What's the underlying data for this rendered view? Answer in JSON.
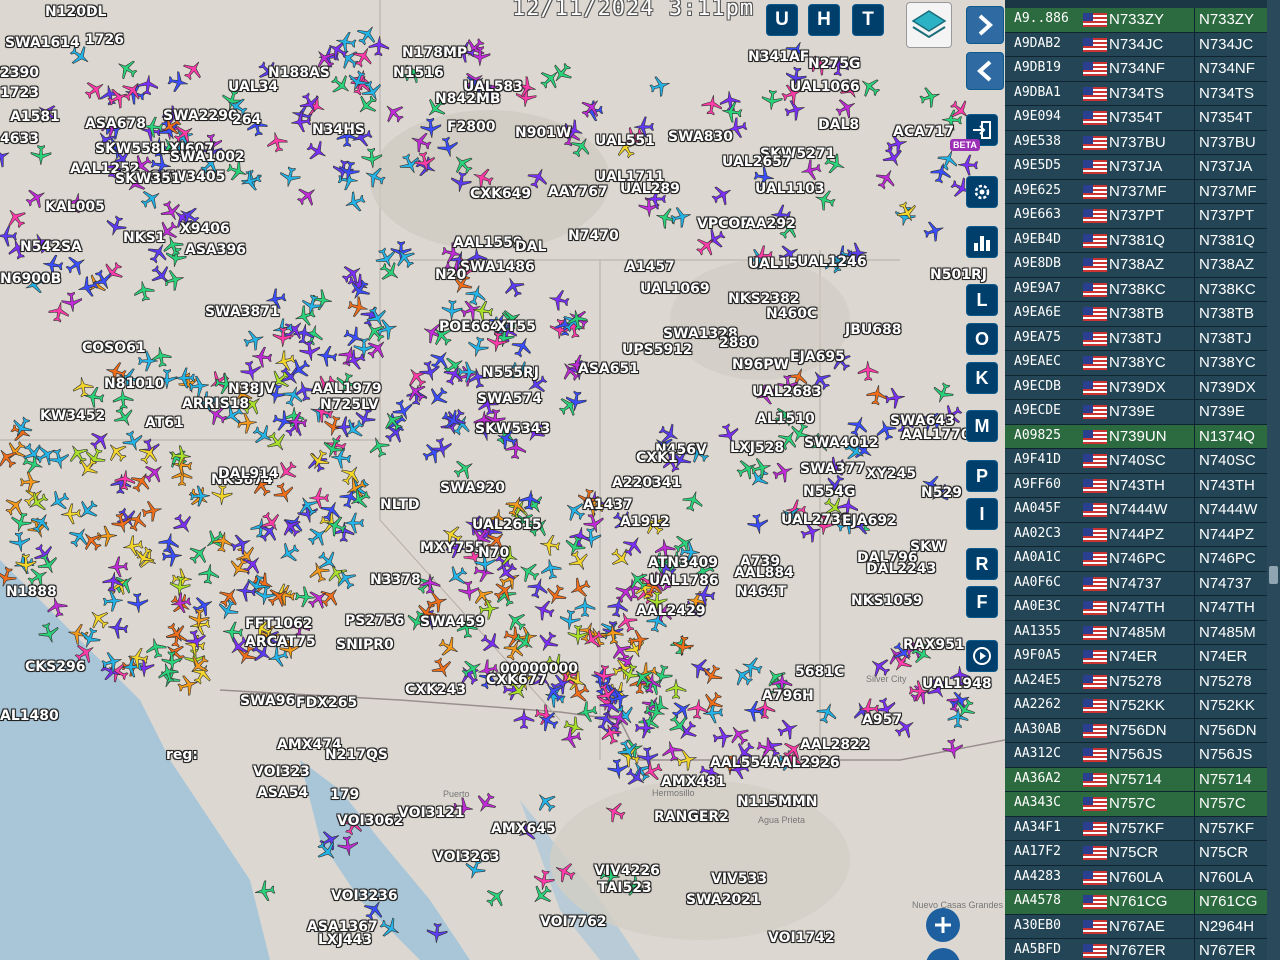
{
  "timestamp": "12/11/2024  3:11pm",
  "top_buttons": [
    "U",
    "H",
    "T"
  ],
  "side_buttons": [
    "L",
    "O",
    "K",
    "M",
    "P",
    "I",
    "R",
    "F"
  ],
  "beta_badge": "BETA",
  "icons": {
    "layers": "layers-icon",
    "next": "chevron-right-icon",
    "back": "chevron-left-icon",
    "login": "login-icon",
    "settings": "gear-icon",
    "stats": "bar-chart-icon",
    "replay": "replay-icon",
    "zoom_in": "plus-icon",
    "panel_toggle": "expand-collapse-icon"
  },
  "colors": {
    "panel_bg": "#1b3645",
    "row_bg": "#234556",
    "row_highlight": "#2c6a3f",
    "button_bg": "#003f6b"
  },
  "map_labels": [
    {
      "t": "N120DL"
    },
    {
      "t": "SWA1614"
    },
    {
      "t": "1726"
    },
    {
      "t": "2390"
    },
    {
      "t": "1723"
    },
    {
      "t": "A1581"
    },
    {
      "t": "ASA678"
    },
    {
      "t": "4633"
    },
    {
      "t": "SKW558"
    },
    {
      "t": "LXJ607"
    },
    {
      "t": "SWA1002"
    },
    {
      "t": "AAL1252"
    },
    {
      "t": "SKW3405"
    },
    {
      "t": "KAL005"
    },
    {
      "t": "SKW351"
    },
    {
      "t": "N542SA"
    },
    {
      "t": "NKS1"
    },
    {
      "t": "X9406"
    },
    {
      "t": "ASA396"
    },
    {
      "t": "N6900B"
    },
    {
      "t": "N178MP"
    },
    {
      "t": "N188AS"
    },
    {
      "t": "N1516"
    },
    {
      "t": "UAL34"
    },
    {
      "t": "SWA2290"
    },
    {
      "t": "264"
    },
    {
      "t": "N34HS"
    },
    {
      "t": "N842MB"
    },
    {
      "t": "UAL583"
    },
    {
      "t": "F2800"
    },
    {
      "t": "N901W"
    },
    {
      "t": "UAL551"
    },
    {
      "t": "SWA830"
    },
    {
      "t": "UAL1711"
    },
    {
      "t": "UAL289"
    },
    {
      "t": "AAY767"
    },
    {
      "t": "CXK649"
    },
    {
      "t": "UAL1103"
    },
    {
      "t": "N341AF"
    },
    {
      "t": "N275G"
    },
    {
      "t": "UAL1066"
    },
    {
      "t": "DAL8"
    },
    {
      "t": "ACA717"
    },
    {
      "t": "SKW5271"
    },
    {
      "t": "UAL2657"
    },
    {
      "t": "AAL1559"
    },
    {
      "t": "DAL"
    },
    {
      "t": "N7470"
    },
    {
      "t": "VPCOP"
    },
    {
      "t": "AA292"
    },
    {
      "t": "UAL15"
    },
    {
      "t": "UAL1246"
    },
    {
      "t": "N501RJ"
    },
    {
      "t": "SWA1486"
    },
    {
      "t": "UAL1069"
    },
    {
      "t": "N20"
    },
    {
      "t": "A1457"
    },
    {
      "t": "NKS2382"
    },
    {
      "t": "N460C"
    },
    {
      "t": "JBU688"
    },
    {
      "t": "SWA3871"
    },
    {
      "t": "POE664"
    },
    {
      "t": "XT55"
    },
    {
      "t": "SWA1328"
    },
    {
      "t": "UPS5912"
    },
    {
      "t": "2880"
    },
    {
      "t": "N96PW"
    },
    {
      "t": "EJA695"
    },
    {
      "t": "AAL1979"
    },
    {
      "t": "N725LV"
    },
    {
      "t": "N555RJ"
    },
    {
      "t": "ASA651"
    },
    {
      "t": "UAL2683"
    },
    {
      "t": "COSO61"
    },
    {
      "t": "N81010"
    },
    {
      "t": "ARRIS18"
    },
    {
      "t": "N38JV"
    },
    {
      "t": "KW3452"
    },
    {
      "t": "AT61"
    },
    {
      "t": "SWA574"
    },
    {
      "t": "SKW5343"
    },
    {
      "t": "AL1510"
    },
    {
      "t": "SWA4012"
    },
    {
      "t": "SWA643"
    },
    {
      "t": "AAL1770"
    },
    {
      "t": "N456V"
    },
    {
      "t": "CXK1"
    },
    {
      "t": "LXJ528"
    },
    {
      "t": "NKS874"
    },
    {
      "t": "DAL914"
    },
    {
      "t": "SWA920"
    },
    {
      "t": "A220341"
    },
    {
      "t": "SWA377"
    },
    {
      "t": "XY245"
    },
    {
      "t": "N554G"
    },
    {
      "t": "N529"
    },
    {
      "t": "NLTD"
    },
    {
      "t": "A1437"
    },
    {
      "t": "UAL2615"
    },
    {
      "t": "A1912"
    },
    {
      "t": "UAL2739"
    },
    {
      "t": "EJA692"
    },
    {
      "t": "MXY755"
    },
    {
      "t": "N70"
    },
    {
      "t": "SKW"
    },
    {
      "t": "N3378"
    },
    {
      "t": "ATN3409"
    },
    {
      "t": "A739"
    },
    {
      "t": "AAL884"
    },
    {
      "t": "DAL796"
    },
    {
      "t": "DAL2243"
    },
    {
      "t": "UAL1786"
    },
    {
      "t": "N464T"
    },
    {
      "t": "NKS1059"
    },
    {
      "t": "FFT1062"
    },
    {
      "t": "ARCAT75"
    },
    {
      "t": "SNIPR0"
    },
    {
      "t": "SWA459"
    },
    {
      "t": "PS2756"
    },
    {
      "t": "AAL2429"
    },
    {
      "t": "RAX951"
    },
    {
      "t": "UAL1948"
    },
    {
      "t": "CKS296"
    },
    {
      "t": "AL1480"
    },
    {
      "t": "FDX265"
    },
    {
      "t": "SWA96"
    },
    {
      "t": "CXK243"
    },
    {
      "t": "CXK677"
    },
    {
      "t": "00000000"
    },
    {
      "t": "5681C"
    },
    {
      "t": "A796H"
    },
    {
      "t": "AAL2822"
    },
    {
      "t": "AAL2926"
    },
    {
      "t": "A957"
    },
    {
      "t": "AMX474"
    },
    {
      "t": "N217QS"
    },
    {
      "t": "VOI323"
    },
    {
      "t": "ASA54"
    },
    {
      "t": "179"
    },
    {
      "t": "AAL554"
    },
    {
      "t": "AMX481"
    },
    {
      "t": "N115MMN"
    },
    {
      "t": "RANGER2"
    },
    {
      "t": "VOI3062"
    },
    {
      "t": "VOI3121"
    },
    {
      "t": "AMX645"
    },
    {
      "t": "VOI3263"
    },
    {
      "t": "VIV4226"
    },
    {
      "t": "TAI523"
    },
    {
      "t": "VIV533"
    },
    {
      "t": "SWA2021"
    },
    {
      "t": "VOI3236"
    },
    {
      "t": "ASA1367"
    },
    {
      "t": "LXJ443"
    },
    {
      "t": "VOI7762"
    },
    {
      "t": "VOI1742"
    },
    {
      "t": "N1888"
    },
    {
      "t": "reg:"
    }
  ],
  "aircraft_list": [
    {
      "hex": "A9..886",
      "reg": "N733ZY",
      "cs": "N733ZY",
      "hl": true
    },
    {
      "hex": "A9DAB2",
      "reg": "N734JC",
      "cs": "N734JC",
      "hl": false
    },
    {
      "hex": "A9DB19",
      "reg": "N734NF",
      "cs": "N734NF",
      "hl": false
    },
    {
      "hex": "A9DBA1",
      "reg": "N734TS",
      "cs": "N734TS",
      "hl": false
    },
    {
      "hex": "A9E094",
      "reg": "N7354T",
      "cs": "N7354T",
      "hl": false
    },
    {
      "hex": "A9E538",
      "reg": "N737BU",
      "cs": "N737BU",
      "hl": false
    },
    {
      "hex": "A9E5D5",
      "reg": "N737JA",
      "cs": "N737JA",
      "hl": false
    },
    {
      "hex": "A9E625",
      "reg": "N737MF",
      "cs": "N737MF",
      "hl": false
    },
    {
      "hex": "A9E663",
      "reg": "N737PT",
      "cs": "N737PT",
      "hl": false
    },
    {
      "hex": "A9EB4D",
      "reg": "N7381Q",
      "cs": "N7381Q",
      "hl": false
    },
    {
      "hex": "A9E8DB",
      "reg": "N738AZ",
      "cs": "N738AZ",
      "hl": false
    },
    {
      "hex": "A9E9A7",
      "reg": "N738KC",
      "cs": "N738KC",
      "hl": false
    },
    {
      "hex": "A9EA6E",
      "reg": "N738TB",
      "cs": "N738TB",
      "hl": false
    },
    {
      "hex": "A9EA75",
      "reg": "N738TJ",
      "cs": "N738TJ",
      "hl": false
    },
    {
      "hex": "A9EAEC",
      "reg": "N738YC",
      "cs": "N738YC",
      "hl": false
    },
    {
      "hex": "A9ECDB",
      "reg": "N739DX",
      "cs": "N739DX",
      "hl": false
    },
    {
      "hex": "A9ECDE",
      "reg": "N739E",
      "cs": "N739E",
      "hl": false
    },
    {
      "hex": "A09825",
      "reg": "N739UN",
      "cs": "N1374Q",
      "hl": true
    },
    {
      "hex": "A9F41D",
      "reg": "N740SC",
      "cs": "N740SC",
      "hl": false
    },
    {
      "hex": "A9FF60",
      "reg": "N743TH",
      "cs": "N743TH",
      "hl": false
    },
    {
      "hex": "AA045F",
      "reg": "N7444W",
      "cs": "N7444W",
      "hl": false
    },
    {
      "hex": "AA02C3",
      "reg": "N744PZ",
      "cs": "N744PZ",
      "hl": false
    },
    {
      "hex": "AA0A1C",
      "reg": "N746PC",
      "cs": "N746PC",
      "hl": false
    },
    {
      "hex": "AA0F6C",
      "reg": "N74737",
      "cs": "N74737",
      "hl": false
    },
    {
      "hex": "AA0E3C",
      "reg": "N747TH",
      "cs": "N747TH",
      "hl": false
    },
    {
      "hex": "AA1355",
      "reg": "N7485M",
      "cs": "N7485M",
      "hl": false
    },
    {
      "hex": "A9F0A5",
      "reg": "N74ER",
      "cs": "N74ER",
      "hl": false
    },
    {
      "hex": "AA24E5",
      "reg": "N75278",
      "cs": "N75278",
      "hl": false
    },
    {
      "hex": "AA2262",
      "reg": "N752KK",
      "cs": "N752KK",
      "hl": false
    },
    {
      "hex": "AA30AB",
      "reg": "N756DN",
      "cs": "N756DN",
      "hl": false
    },
    {
      "hex": "AA312C",
      "reg": "N756JS",
      "cs": "N756JS",
      "hl": false
    },
    {
      "hex": "AA36A2",
      "reg": "N75714",
      "cs": "N75714",
      "hl": true
    },
    {
      "hex": "AA343C",
      "reg": "N757C",
      "cs": "N757C",
      "hl": true
    },
    {
      "hex": "AA34F1",
      "reg": "N757KF",
      "cs": "N757KF",
      "hl": false
    },
    {
      "hex": "AA17F2",
      "reg": "N75CR",
      "cs": "N75CR",
      "hl": false
    },
    {
      "hex": "AA4283",
      "reg": "N760LA",
      "cs": "N760LA",
      "hl": false
    },
    {
      "hex": "AA4578",
      "reg": "N761CG",
      "cs": "N761CG",
      "hl": true
    },
    {
      "hex": "A30EB0",
      "reg": "N767AE",
      "cs": "N2964H",
      "hl": false
    },
    {
      "hex": "AA5BFD",
      "reg": "N767ER",
      "cs": "N767ER",
      "hl": false
    }
  ],
  "place_labels": [
    "Hermosillo",
    "Agua Prieta",
    "Nuevo Casas Grandes",
    "Silver City",
    "Puerto"
  ]
}
